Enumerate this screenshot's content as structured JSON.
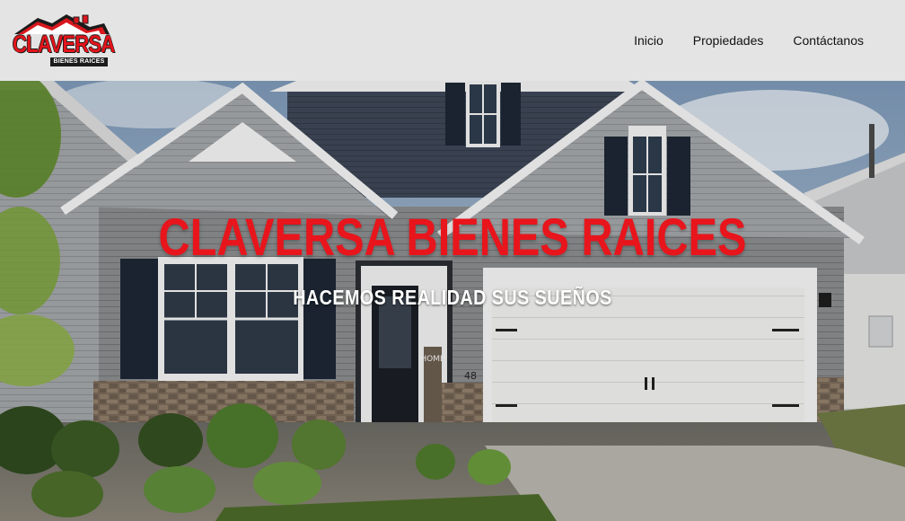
{
  "brand": {
    "name": "CLAVERSA",
    "tagline": "BIENES RAICES"
  },
  "nav": {
    "items": [
      "Inicio",
      "Propiedades",
      "Contáctanos"
    ]
  },
  "hero": {
    "title": "CLAVERSA BIENES RAICES",
    "subtitle": "HACEMOS REALIDAD SUS SUEÑOS",
    "house_number": "48",
    "door_sign": "HOME"
  },
  "colors": {
    "header_bg": "#e4e4e4",
    "brand_red": "#e8151c",
    "subtitle_white": "#ffffff",
    "nav_text": "#111111"
  },
  "icons": [
    "house-roof-logo-icon"
  ]
}
